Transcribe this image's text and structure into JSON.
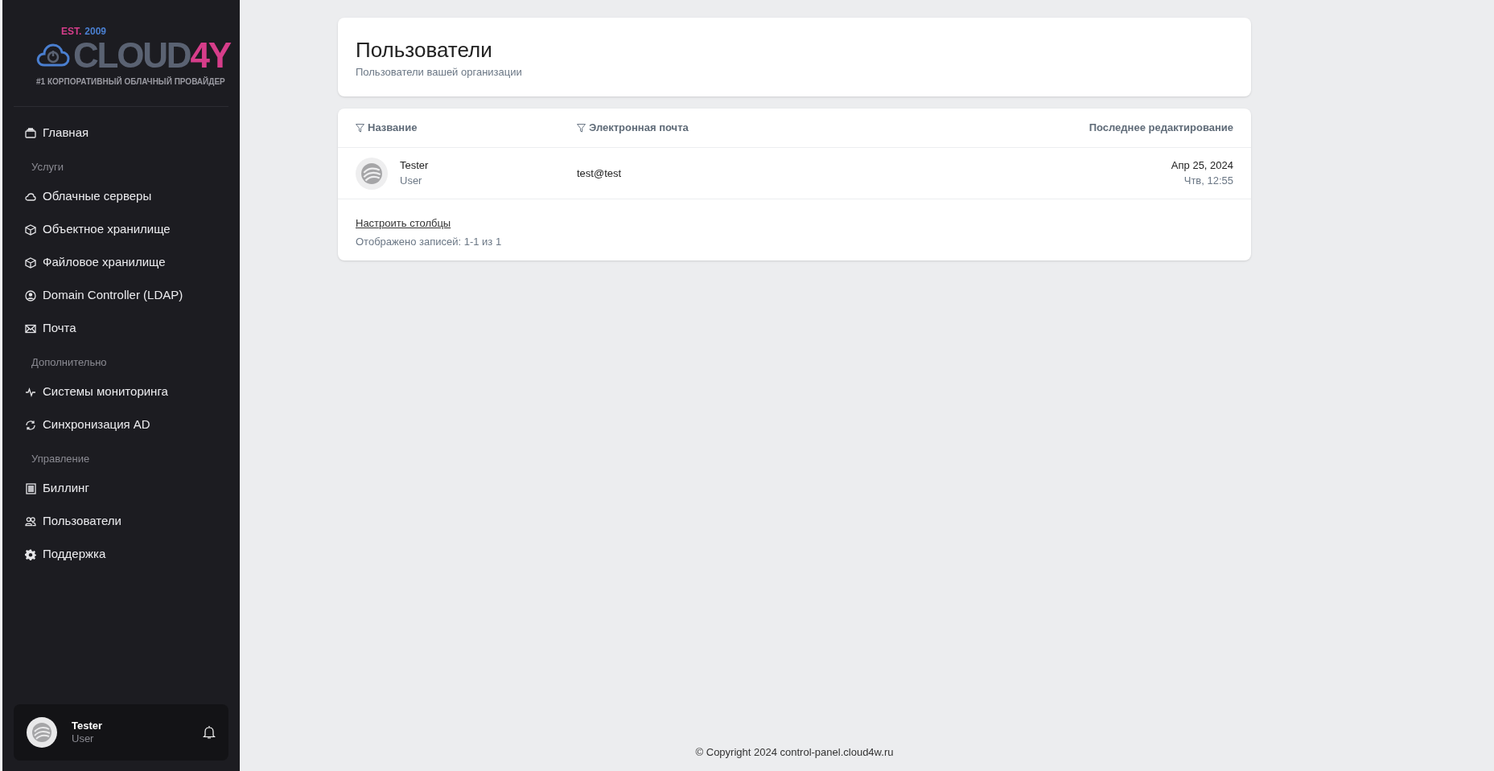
{
  "sidebar": {
    "logo": {
      "est": "EST.",
      "year": "2009",
      "brand": "CLOUD",
      "brand_accent": "4Y",
      "tagline": "#1 КОРПОРАТИВНЫЙ ОБЛАЧНЫЙ ПРОВАЙДЕР"
    },
    "groups": [
      {
        "items": [
          {
            "label": "Главная",
            "kind": "home"
          }
        ]
      },
      {
        "heading": "Услуги",
        "items": [
          {
            "label": "Облачные серверы",
            "kind": "cloud"
          },
          {
            "label": "Объектное хранилище",
            "kind": "box"
          },
          {
            "label": "Файловое хранилище",
            "kind": "box"
          },
          {
            "label": "Domain Controller (LDAP)",
            "kind": "user"
          },
          {
            "label": "Почта",
            "kind": "mail"
          }
        ]
      },
      {
        "heading": "Дополнительно",
        "items": [
          {
            "label": "Системы мониторинга",
            "kind": "pulse"
          },
          {
            "label": "Синхронизация AD",
            "kind": "sync"
          }
        ]
      },
      {
        "heading": "Управление",
        "items": [
          {
            "label": "Биллинг",
            "kind": "billing"
          },
          {
            "label": "Пользователи",
            "kind": "users"
          },
          {
            "label": "Поддержка",
            "kind": "gear"
          }
        ]
      }
    ],
    "user": {
      "name": "Tester",
      "role": "User"
    }
  },
  "header": {
    "title": "Пользователи",
    "subtitle": "Пользователи вашей организации"
  },
  "table": {
    "columns": [
      {
        "label": "Название",
        "filterable": true
      },
      {
        "label": "Электронная почта",
        "filterable": true
      },
      {
        "label": "Последнее редактирование",
        "filterable": false
      }
    ],
    "rows": [
      {
        "name": "Tester",
        "role": "User",
        "email": "test@test",
        "date": "Апр 25, 2024",
        "time": "Чтв, 12:55"
      }
    ],
    "configure_link": "Настроить столбцы",
    "record_count": "Отображено записей: 1-1 из 1"
  },
  "footer": "© Copyright 2024 control-panel.cloud4w.ru"
}
